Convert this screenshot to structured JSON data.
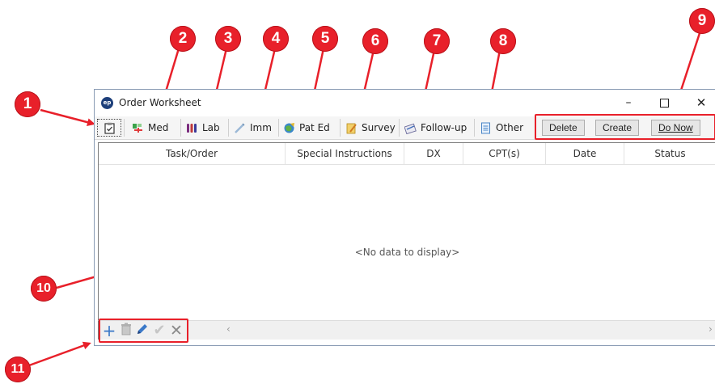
{
  "window": {
    "title": "Order Worksheet",
    "app_icon_text": "ep",
    "controls": {
      "minimize": "–",
      "close": "✕"
    }
  },
  "toolbar": {
    "items": [
      {
        "label": "",
        "icon": "clipboard-icon"
      },
      {
        "label": "Med",
        "icon": "medication-icon"
      },
      {
        "label": "Lab",
        "icon": "lab-tubes-icon"
      },
      {
        "label": "Imm",
        "icon": "syringe-icon"
      },
      {
        "label": "Pat Ed",
        "icon": "patient-education-icon"
      },
      {
        "label": "Survey",
        "icon": "survey-icon"
      },
      {
        "label": "Follow-up",
        "icon": "follow-up-icon"
      },
      {
        "label": "Other",
        "icon": "document-icon"
      }
    ],
    "actions": {
      "delete": "Delete",
      "create": "Create",
      "do_now": "Do Now"
    }
  },
  "grid": {
    "columns": [
      "Task/Order",
      "Special Instructions",
      "DX",
      "CPT(s)",
      "Date",
      "Status"
    ],
    "empty_text": "<No data to display>"
  },
  "bottom_bar": {
    "icons": [
      "add-icon",
      "delete-icon",
      "edit-icon",
      "check-icon",
      "close-icon"
    ],
    "scroll_left": "‹",
    "scroll_right": "›"
  },
  "callouts": [
    "1",
    "2",
    "3",
    "4",
    "5",
    "6",
    "7",
    "8",
    "9",
    "10",
    "11"
  ],
  "colors": {
    "callout_red": "#e8202a",
    "window_border": "#8a9bb4"
  }
}
